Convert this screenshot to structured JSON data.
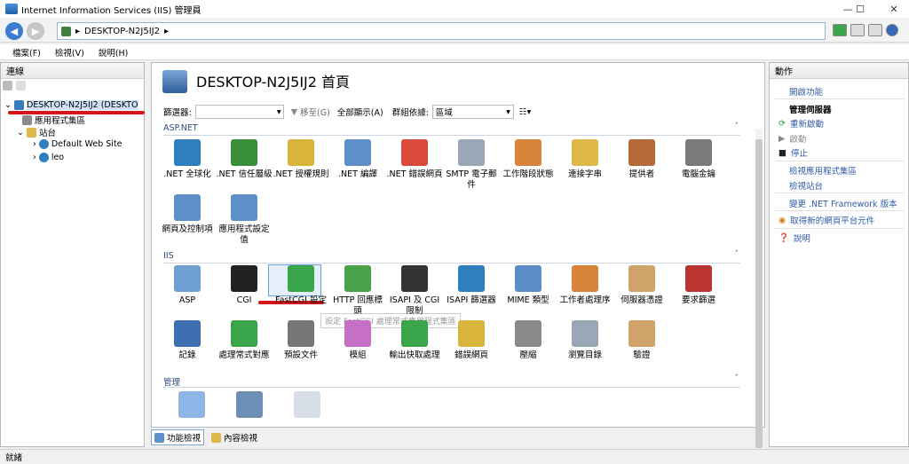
{
  "window": {
    "title": "Internet Information Services (IIS) 管理員"
  },
  "address": {
    "path": "DESKTOP-N2J5IJ2"
  },
  "menu": [
    "檔案(F)",
    "檢視(V)",
    "說明(H)"
  ],
  "connections": {
    "header": "連線",
    "server": "DESKTOP-N2J5IJ2 (DESKTO",
    "app_pools": "應用程式集區",
    "sites": "站台",
    "site_items": [
      "Default Web Site",
      "leo"
    ]
  },
  "center": {
    "title": "DESKTOP-N2J5IJ2 首頁",
    "filter_label": "篩選器:",
    "go_label": "移至(G)",
    "show_all_label": "全部顯示(A)",
    "group_label": "群組依據:",
    "group_value": "區域",
    "sections": {
      "aspnet": "ASP.NET",
      "iis": "IIS",
      "mgmt": "管理"
    },
    "aspnet_features": [
      ".NET 全球化",
      ".NET 信任層級",
      ".NET 授權規則",
      ".NET 編譯",
      ".NET 錯誤網頁",
      "SMTP 電子郵件",
      "工作階段狀態",
      "連接字串",
      "提供者",
      "電腦金鑰",
      "網頁及控制項",
      "應用程式設定值"
    ],
    "iis_features": [
      "ASP",
      "CGI",
      "FastCGI 設定",
      "HTTP 回應標頭",
      "ISAPI 及 CGI 限制",
      "ISAPI 篩選器",
      "MIME 類型",
      "工作者處理序",
      "伺服器憑證",
      "要求篩選",
      "記錄",
      "處理常式對應",
      "預設文件",
      "模組",
      "輸出快取處理",
      "錯誤網頁",
      "壓縮",
      "瀏覽目錄",
      "驗證"
    ],
    "tooltip": "設定 FastCGI 處理常式應用程式集區"
  },
  "bottom_tabs": {
    "features": "功能檢視",
    "content": "內容檢視"
  },
  "actions": {
    "header": "動作",
    "open_feature": "開啟功能",
    "manage_server": "管理伺服器",
    "restart": "重新啟動",
    "start": "啟動",
    "stop": "停止",
    "view_pools": "檢視應用程式集區",
    "view_sites": "檢視站台",
    "change_net": "變更 .NET Framework 版本",
    "get_web": "取得新的網頁平台元件",
    "help": "說明"
  },
  "status": {
    "text": "就緒"
  },
  "colors": {
    "accent": "#2e5aa8",
    "annotation_red": "#d4161a"
  }
}
